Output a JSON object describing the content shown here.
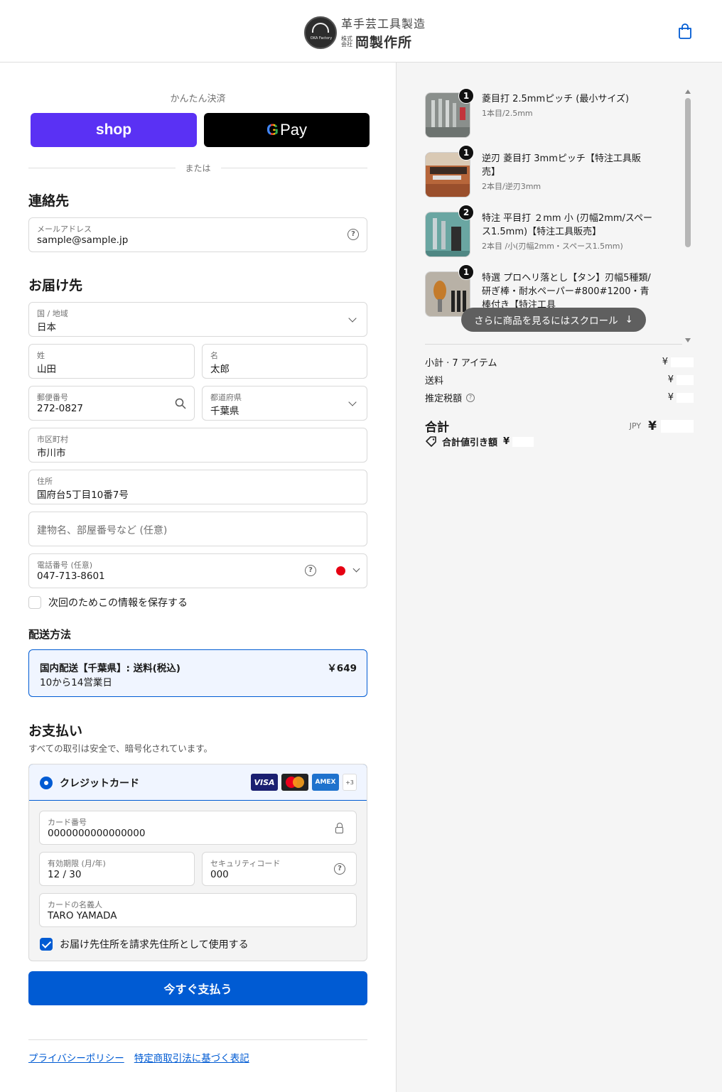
{
  "header": {
    "logo_line1": "革手芸工具製造",
    "logo_kabu": "株式会社",
    "logo_name": "岡製作所",
    "logo_circle_text": "OKA Factory"
  },
  "express": {
    "label": "かんたん決済",
    "shop_label": "shop",
    "gpay_g": "G",
    "gpay_label": "Pay",
    "or_label": "または"
  },
  "contact": {
    "title": "連絡先",
    "email_label": "メールアドレス",
    "email_value": "sample@sample.jp"
  },
  "delivery": {
    "title": "お届け先",
    "country_label": "国 / 地域",
    "country_value": "日本",
    "last_name_label": "姓",
    "last_name_value": "山田",
    "first_name_label": "名",
    "first_name_value": "太郎",
    "postal_label": "郵便番号",
    "postal_value": "272-0827",
    "prefecture_label": "都道府県",
    "prefecture_value": "千葉県",
    "city_label": "市区町村",
    "city_value": "市川市",
    "address_label": "住所",
    "address_value": "国府台5丁目10番7号",
    "building_placeholder": "建物名、部屋番号など (任意)",
    "phone_label": "電話番号 (任意)",
    "phone_value": "047-713-8601",
    "save_info_label": "次回のためこの情報を保存する"
  },
  "shipping": {
    "title": "配送方法",
    "name": "国内配送【千葉県】: 送料(税込)",
    "days": "10から14営業日",
    "price": "￥649"
  },
  "payment": {
    "title": "お支払い",
    "subtitle": "すべての取引は安全で、暗号化されています。",
    "method_label": "クレジットカード",
    "card_logos": [
      "VISA",
      "AMEX",
      "+3"
    ],
    "card_number_label": "カード番号",
    "card_number_value": "0000000000000000",
    "expiry_label": "有効期限 (月/年)",
    "expiry_value": "12 / 30",
    "cvc_label": "セキュリティコード",
    "cvc_value": "000",
    "name_label": "カードの名義人",
    "name_value": "TARO YAMADA",
    "billing_same_label": "お届け先住所を請求先住所として使用する",
    "pay_button": "今すぐ支払う"
  },
  "footer": {
    "privacy": "プライバシーポリシー",
    "tokusho": "特定商取引法に基づく表記"
  },
  "cart": {
    "items": [
      {
        "qty": "1",
        "title": "菱目打 2.5mmピッチ (最小サイズ)",
        "variant": "1本目/2.5mm"
      },
      {
        "qty": "1",
        "title": "逆刃 菱目打 3mmピッチ【特注工具販売】",
        "variant": "2本目/逆刃3mm"
      },
      {
        "qty": "2",
        "title": "特注 平目打 ２mm 小 (刃幅2mm/スペース1.5mm)【特注工具販売】",
        "variant": "2本目 /小(刃幅2mm・スペース1.5mm)"
      },
      {
        "qty": "1",
        "title": "特選 プロヘリ落とし【タン】刃幅5種類/ 研ぎ棒・耐水ペーパー#800#1200・青棒付き【特注工具",
        "variant": ""
      }
    ],
    "scroll_hint": "さらに商品を見るにはスクロール",
    "scroll_arrow": "↓",
    "subtotal_label": "小計 · 7 アイテム",
    "subtotal_yen": "¥",
    "shipping_label": "送料",
    "shipping_yen": "¥",
    "tax_label": "推定税額",
    "tax_yen": "¥",
    "total_label": "合計",
    "currency": "JPY",
    "total_yen": "¥",
    "discount_label": "合計値引き額",
    "discount_yen": "¥"
  },
  "colors": {
    "accent": "#005bd3",
    "shop_purple": "#5a31f4"
  }
}
